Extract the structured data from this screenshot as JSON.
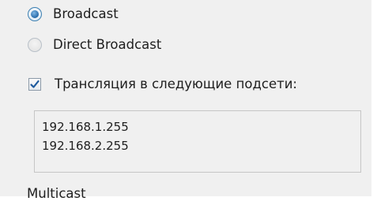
{
  "broadcast_options": {
    "broadcast_label": "Broadcast",
    "broadcast_selected": true,
    "direct_broadcast_label": "Direct Broadcast",
    "direct_broadcast_selected": false
  },
  "subnet_broadcast": {
    "checkbox_label": "Трансляция в следующие подсети:",
    "checked": true,
    "subnets": [
      "192.168.1.255",
      "192.168.2.255"
    ]
  },
  "next_section": {
    "label": "Multicast"
  }
}
